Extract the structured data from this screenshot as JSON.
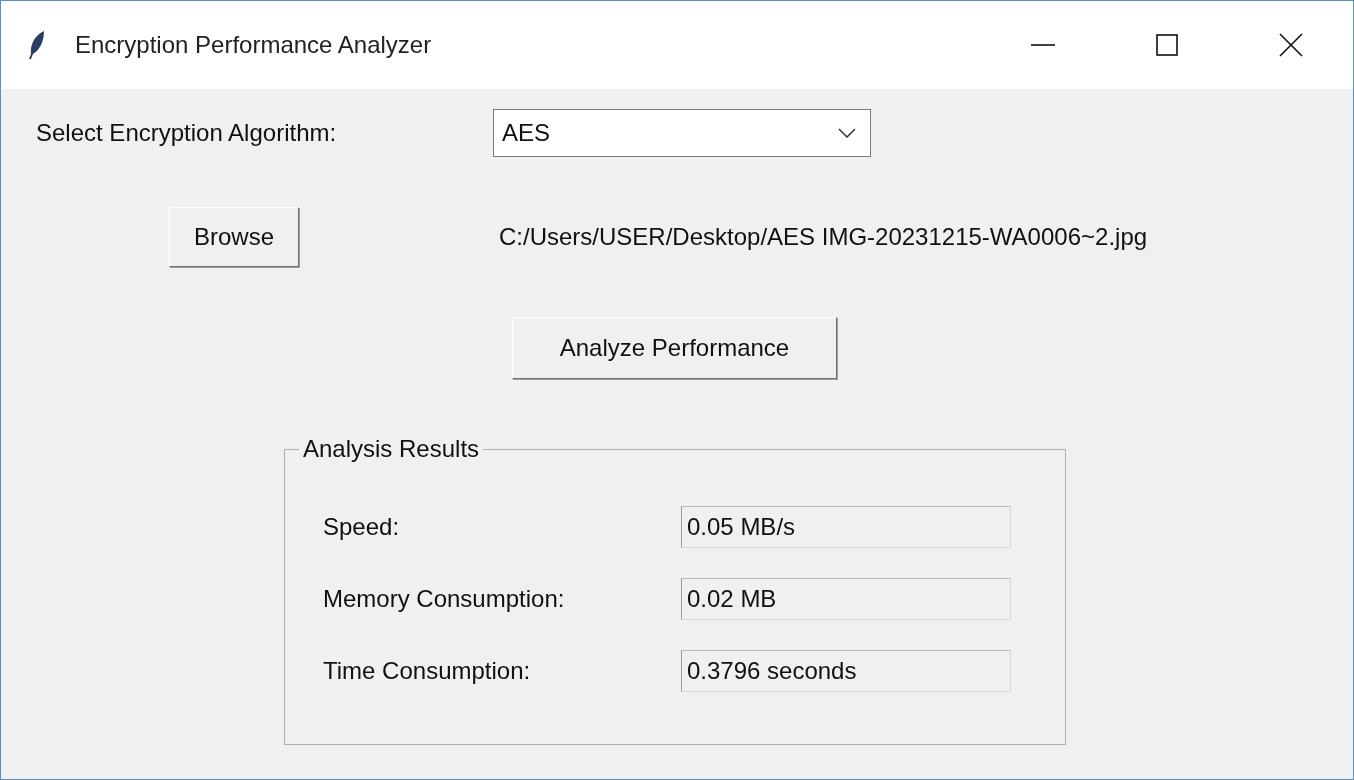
{
  "window": {
    "title": "Encryption Performance Analyzer"
  },
  "algorithm": {
    "label": "Select Encryption Algorithm:",
    "value": "AES"
  },
  "browse": {
    "button": "Browse",
    "path": "C:/Users/USER/Desktop/AES IMG-20231215-WA0006~2.jpg"
  },
  "analyze_button": "Analyze Performance",
  "results": {
    "title": "Analysis Results",
    "rows": [
      {
        "label": "Speed:",
        "value": "0.05 MB/s"
      },
      {
        "label": "Memory Consumption:",
        "value": "0.02 MB"
      },
      {
        "label": "Time Consumption:",
        "value": "0.3796 seconds"
      }
    ]
  }
}
